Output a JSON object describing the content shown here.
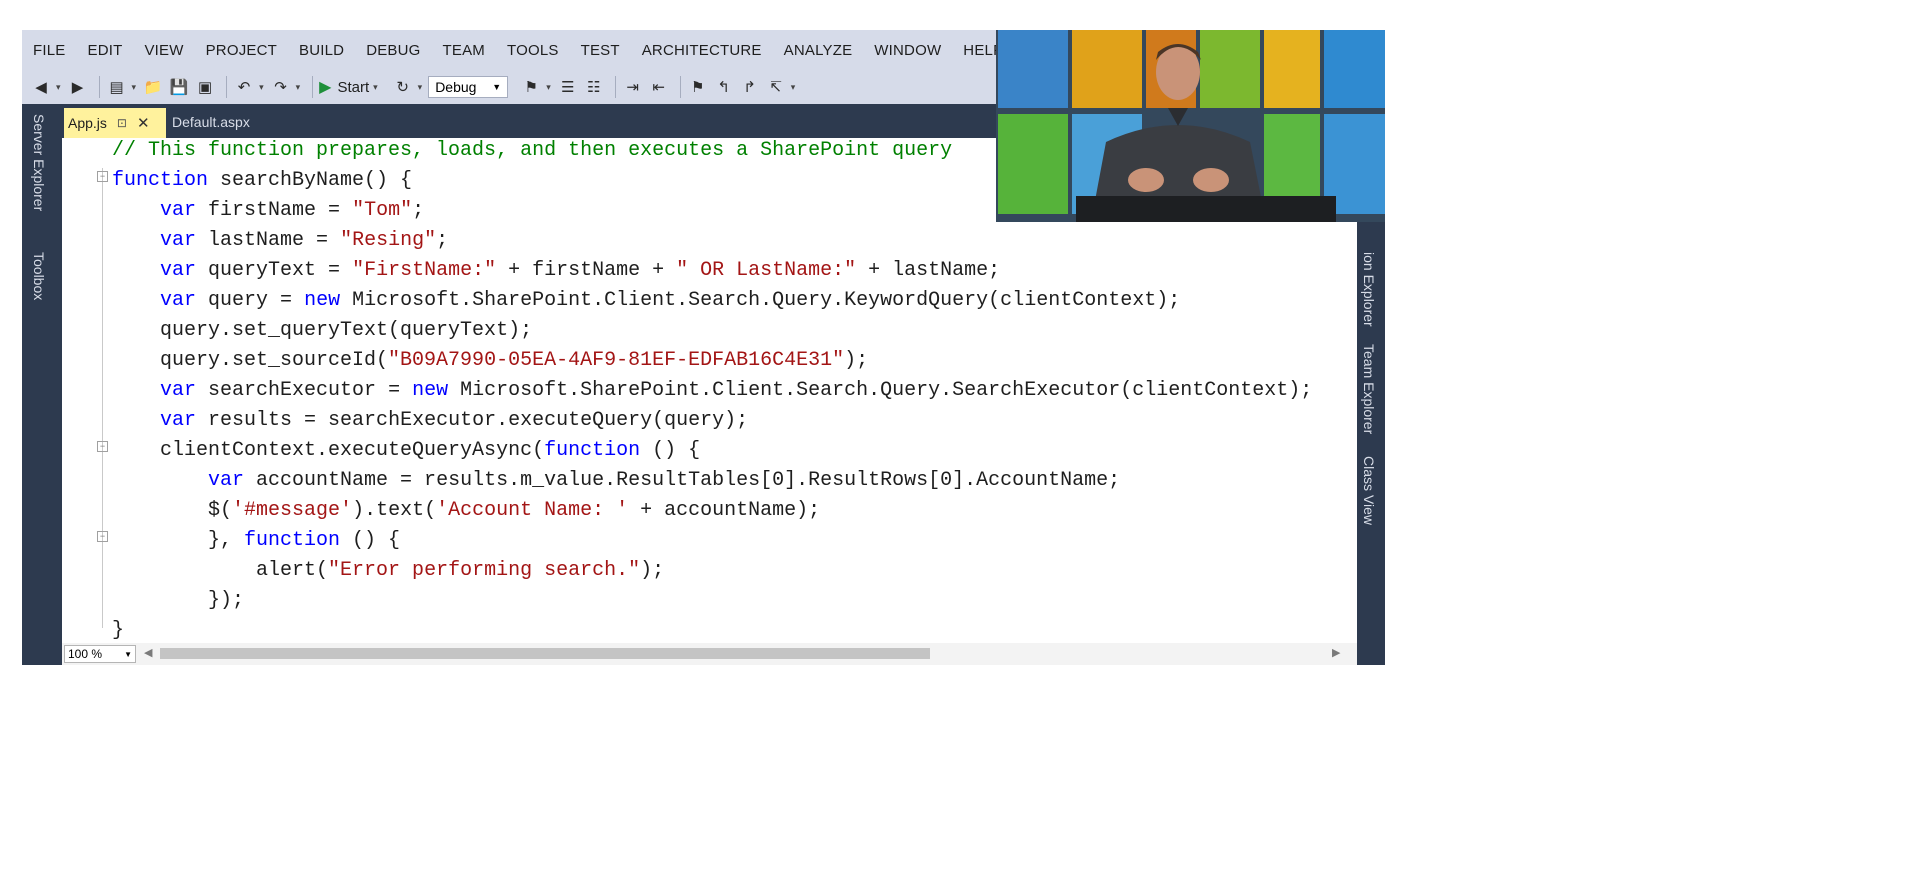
{
  "menu": [
    "FILE",
    "EDIT",
    "VIEW",
    "PROJECT",
    "BUILD",
    "DEBUG",
    "TEAM",
    "TOOLS",
    "TEST",
    "ARCHITECTURE",
    "ANALYZE",
    "WINDOW",
    "HELP"
  ],
  "toolbar": {
    "start_label": "Start",
    "configuration": "Debug"
  },
  "side_panels": {
    "left": [
      "Server Explorer",
      "Toolbox"
    ],
    "right": [
      "ion Explorer",
      "Team Explorer",
      "Class View"
    ]
  },
  "tabs": {
    "active": "App.js",
    "inactive": "Default.aspx"
  },
  "editor": {
    "zoom": "100 %"
  },
  "code_lines": [
    [
      "// This function prepares, loads, and then executes a SharePoint query"
    ],
    [
      "function searchByName() {"
    ],
    [
      "    var firstName = \"Tom\";"
    ],
    [
      "    var lastName = \"Resing\";"
    ],
    [
      "    var queryText = \"FirstName:\" + firstName + \" OR LastName:\" + lastName;"
    ],
    [
      "    var query = new Microsoft.SharePoint.Client.Search.Query.KeywordQuery(clientContext);"
    ],
    [
      "    query.set_queryText(queryText);"
    ],
    [
      "    query.set_sourceId(\"B09A7990-05EA-4AF9-81EF-EDFAB16C4E31\");"
    ],
    [
      "    var searchExecutor = new Microsoft.SharePoint.Client.Search.Query.SearchExecutor(clientContext);"
    ],
    [
      "    var results = searchExecutor.executeQuery(query);"
    ],
    [
      "    clientContext.executeQueryAsync(function () {"
    ],
    [
      "        var accountName = results.m_value.ResultTables[0].ResultRows[0].AccountName;"
    ],
    [
      "        $('#message').text('Account Name: ' + accountName);"
    ],
    [
      "        }, function () {"
    ],
    [
      "            alert(\"Error performing search.\");"
    ],
    [
      "        });"
    ],
    [
      "}"
    ]
  ],
  "colors": {
    "chrome": "#d6dbe9",
    "dark_frame": "#2d3a4f",
    "active_tab": "#fff29d",
    "keyword": "#0000ff",
    "string": "#a31515",
    "comment": "#008000"
  }
}
